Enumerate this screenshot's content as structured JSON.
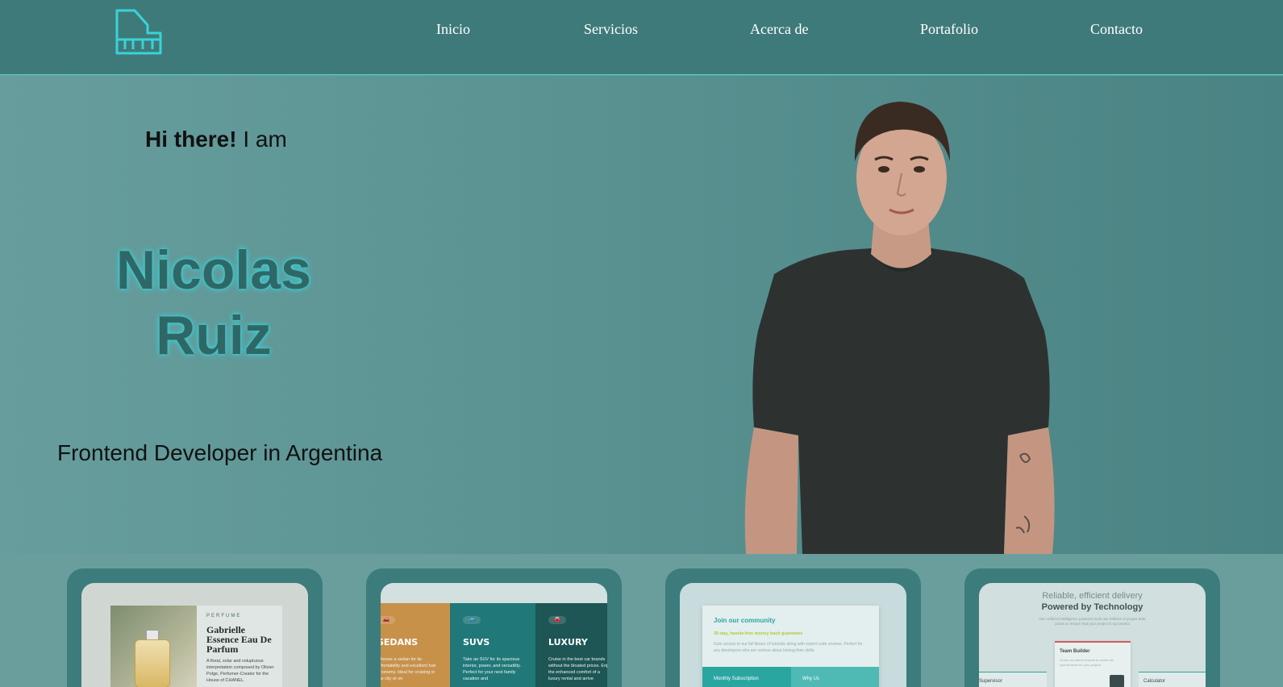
{
  "header": {
    "logo_icon": "piano-icon",
    "nav": [
      {
        "label": "Inicio"
      },
      {
        "label": "Servicios"
      },
      {
        "label": "Acerca de"
      },
      {
        "label": "Portafolio"
      },
      {
        "label": "Contacto"
      }
    ]
  },
  "hero": {
    "greeting_bold": "Hi there!",
    "greeting_rest": " I am",
    "first_name": "Nicolas",
    "last_name": "Ruiz",
    "subtitle": "Frontend Developer in Argentina",
    "portrait": "person-photo"
  },
  "projects": [
    {
      "kicker": "PERFUME",
      "title": "Gabrielle Essence Eau De Parfum",
      "description": "A floral, solar and voluptuous interpretation composed by Olivier Polge, Perfumer-Creator for the House of CHANEL."
    },
    {
      "columns": [
        {
          "title": "SEDANS",
          "description": "Choose a sedan for its affordability and excellent fuel economy. Ideal for cruising in the city or on"
        },
        {
          "title": "SUVS",
          "description": "Take an SUV for its spacious interior, power, and versatility. Perfect for your next family vacation and"
        },
        {
          "title": "LUXURY",
          "description": "Cruise in the best car brands without the bloated prices. Enjoy the enhanced comfort of a luxury rental and arrive"
        }
      ]
    },
    {
      "title": "Join our community",
      "subtitle": "30-day, hassle-free money back guarantee",
      "description": "Gain access to our full library of tutorials along with expert code reviews. Perfect for any developers who are serious about honing their skills.",
      "left_label": "Monthly Subscription",
      "right_label": "Why Us"
    },
    {
      "title_light": "Reliable, efficient delivery",
      "title_bold": "Powered by Technology",
      "description": "Our Artificial Intelligence powered tools use millions of project data points to ensure that your project is successful",
      "card_title": "Team Builder",
      "card_description": "Scans our talent network to create the optimal team for your project",
      "left_label": "Supervisor",
      "right_label": "Calculator"
    }
  ],
  "colors": {
    "header_bg": "#3f7a7a",
    "accent": "#39d3d8",
    "hero_bg": "#5a9292",
    "name_color": "#2f6767"
  }
}
